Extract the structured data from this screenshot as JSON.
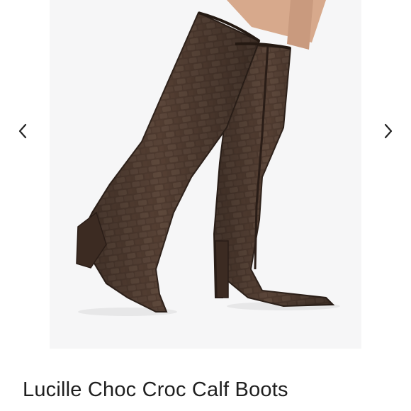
{
  "product": {
    "title": "Lucille Choc Croc Calf Boots"
  },
  "gallery": {
    "prev_icon": "chevron-left-icon",
    "next_icon": "chevron-right-icon",
    "image_subject": "boots-photo",
    "colors": {
      "leather": "#4e3a2f",
      "leather_dark": "#2f221b",
      "background": "#f6f6f7",
      "skin": "#d7a98c"
    }
  }
}
